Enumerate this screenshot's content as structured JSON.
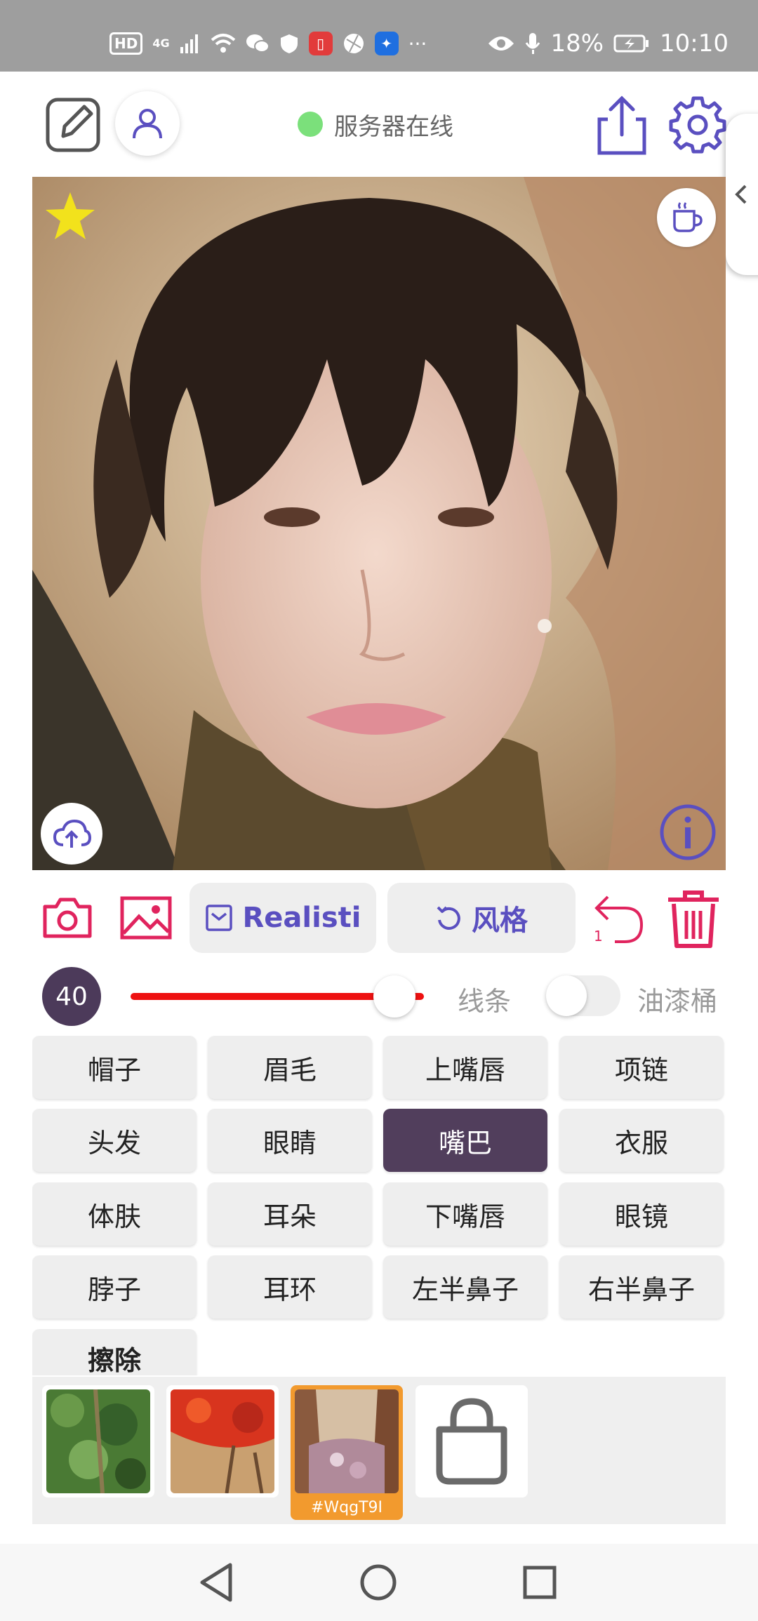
{
  "status_bar": {
    "hd_label": "HD",
    "signal_label": "4G",
    "more_label": "···",
    "battery_percent": "18%",
    "time": "10:10"
  },
  "header": {
    "server_status": "服务器在线",
    "server_status_color": "#7be07b"
  },
  "toolbar": {
    "model_label": "Realisti",
    "style_label": "风格",
    "undo_count": "1"
  },
  "brush": {
    "size": "40",
    "slider_level": 0.9,
    "line_label": "线条",
    "bucket_label": "油漆桶",
    "bucket_enabled": false
  },
  "parts": [
    {
      "label": "帽子"
    },
    {
      "label": "眉毛"
    },
    {
      "label": "上嘴唇"
    },
    {
      "label": "项链"
    },
    {
      "label": "头发"
    },
    {
      "label": "眼睛"
    },
    {
      "label": "嘴巴",
      "selected": true
    },
    {
      "label": "衣服"
    },
    {
      "label": "体肤"
    },
    {
      "label": "耳朵"
    },
    {
      "label": "下嘴唇"
    },
    {
      "label": "眼镜"
    },
    {
      "label": "脖子"
    },
    {
      "label": "耳环"
    },
    {
      "label": "左半鼻子"
    },
    {
      "label": "右半鼻子"
    },
    {
      "label": "擦除"
    }
  ],
  "palette": {
    "selected_label": "#WqgT9I"
  },
  "colors": {
    "accent": "#5a4fc0",
    "pink": "#e0245e",
    "selected_part": "#513e5c",
    "slider": "#ee1111",
    "selected_thumb": "#f29a2e"
  },
  "icons": [
    "edit-icon",
    "user-icon",
    "share-icon",
    "gear-icon",
    "chevron-left-icon",
    "star-icon",
    "coffee-icon",
    "cloud-upload-icon",
    "info-icon",
    "camera-icon",
    "image-icon",
    "checkbox-icon",
    "rotate-icon",
    "undo-icon",
    "trash-icon",
    "shopping-bag-icon",
    "back-triangle-icon",
    "home-circle-icon",
    "recent-square-icon"
  ]
}
